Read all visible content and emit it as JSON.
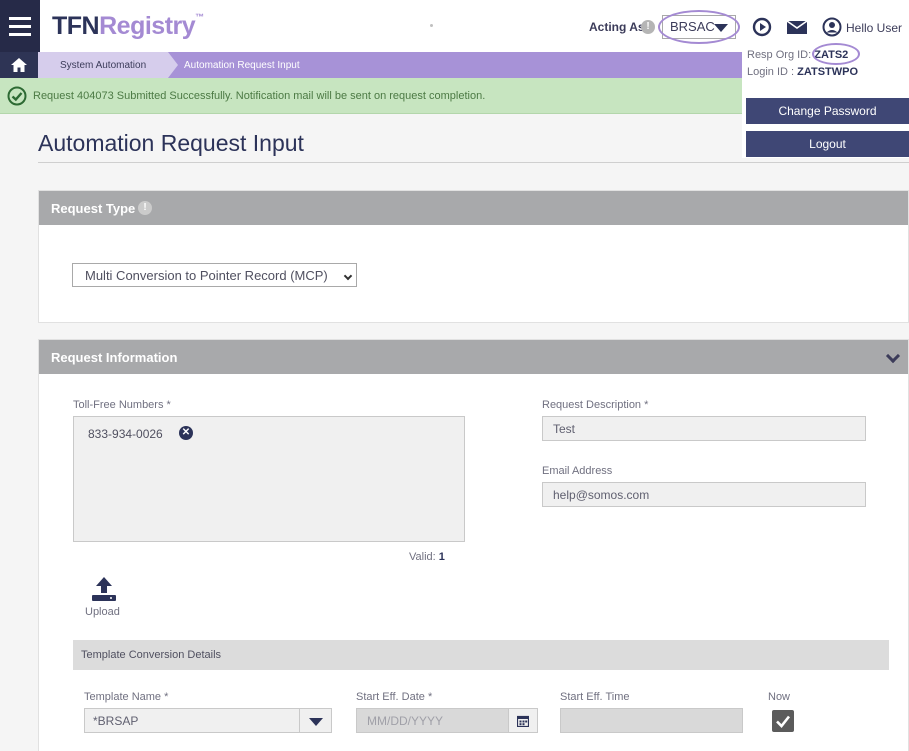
{
  "header": {
    "logo_main": "TFN",
    "logo_accent": "Registry",
    "logo_tm": "™",
    "acting_as_label": "Acting As",
    "acting_as_value": "BRSAC",
    "greeting": "Hello User"
  },
  "breadcrumb": {
    "items": [
      "System Automation",
      "Automation Request Input"
    ]
  },
  "alert": {
    "message": "Request 404073 Submitted Successfully. Notification mail will be sent on request completion."
  },
  "user_menu": {
    "resp_org_label": "Resp Org ID:",
    "resp_org_value": "ZATS2",
    "login_label": "Login ID :",
    "login_value": "ZATSTWPO",
    "change_password_label": "Change Password",
    "logout_label": "Logout"
  },
  "page": {
    "title": "Automation Request Input"
  },
  "request_type": {
    "heading": "Request Type",
    "selected": "Multi Conversion to Pointer Record (MCP)"
  },
  "request_info": {
    "heading": "Request Information",
    "tfn_label": "Toll-Free Numbers *",
    "tfn_values": [
      "833-934-0026"
    ],
    "valid_label": "Valid:",
    "valid_count": "1",
    "upload_label": "Upload",
    "description_label": "Request Description *",
    "description_value": "Test",
    "email_label": "Email Address",
    "email_value": "help@somos.com"
  },
  "template_conversion": {
    "heading": "Template Conversion Details",
    "template_name_label": "Template Name *",
    "template_name_value": "*BRSAP",
    "start_date_label": "Start Eff. Date *",
    "start_date_placeholder": "MM/DD/YYYY",
    "start_time_label": "Start Eff. Time",
    "now_label": "Now",
    "now_checked": true
  },
  "colors": {
    "navy": "#2c3359",
    "lavender": "#a48ad3",
    "success_bg": "#c7e5c0",
    "panel_header": "#a8a9ab"
  }
}
